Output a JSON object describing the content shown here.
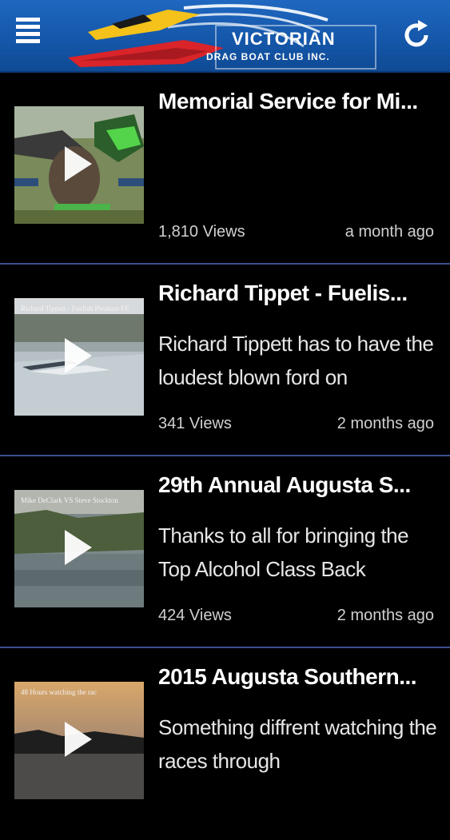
{
  "header": {
    "logo_main": "VICTORIAN",
    "logo_sub": "DRAG BOAT CLUB INC.",
    "menu_icon": "hamburger-menu-icon",
    "refresh_icon": "refresh-icon",
    "color": "#1456a8"
  },
  "videos": [
    {
      "title": "Memorial Service for Mi...",
      "description": "",
      "views": "1,810 Views",
      "age": "a month ago",
      "thumb_caption": ""
    },
    {
      "title": "Richard Tippet - Fuelis...",
      "description": "Richard Tippett has to have the loudest blown ford on",
      "views": "341 Views",
      "age": "2 months ago",
      "thumb_caption": "Richard Tippett - Fuelish Pleasure FE"
    },
    {
      "title": "29th Annual Augusta S...",
      "description": "Thanks to all for bringing the Top Alcohol Class Back",
      "views": "424 Views",
      "age": "2 months ago",
      "thumb_caption": "Mike DeClark VS Steve Stockton"
    },
    {
      "title": "2015 Augusta Southern...",
      "description": "Something diffrent watching the races through",
      "views": "",
      "age": "",
      "thumb_caption": "48 Hours watching the rac"
    }
  ]
}
